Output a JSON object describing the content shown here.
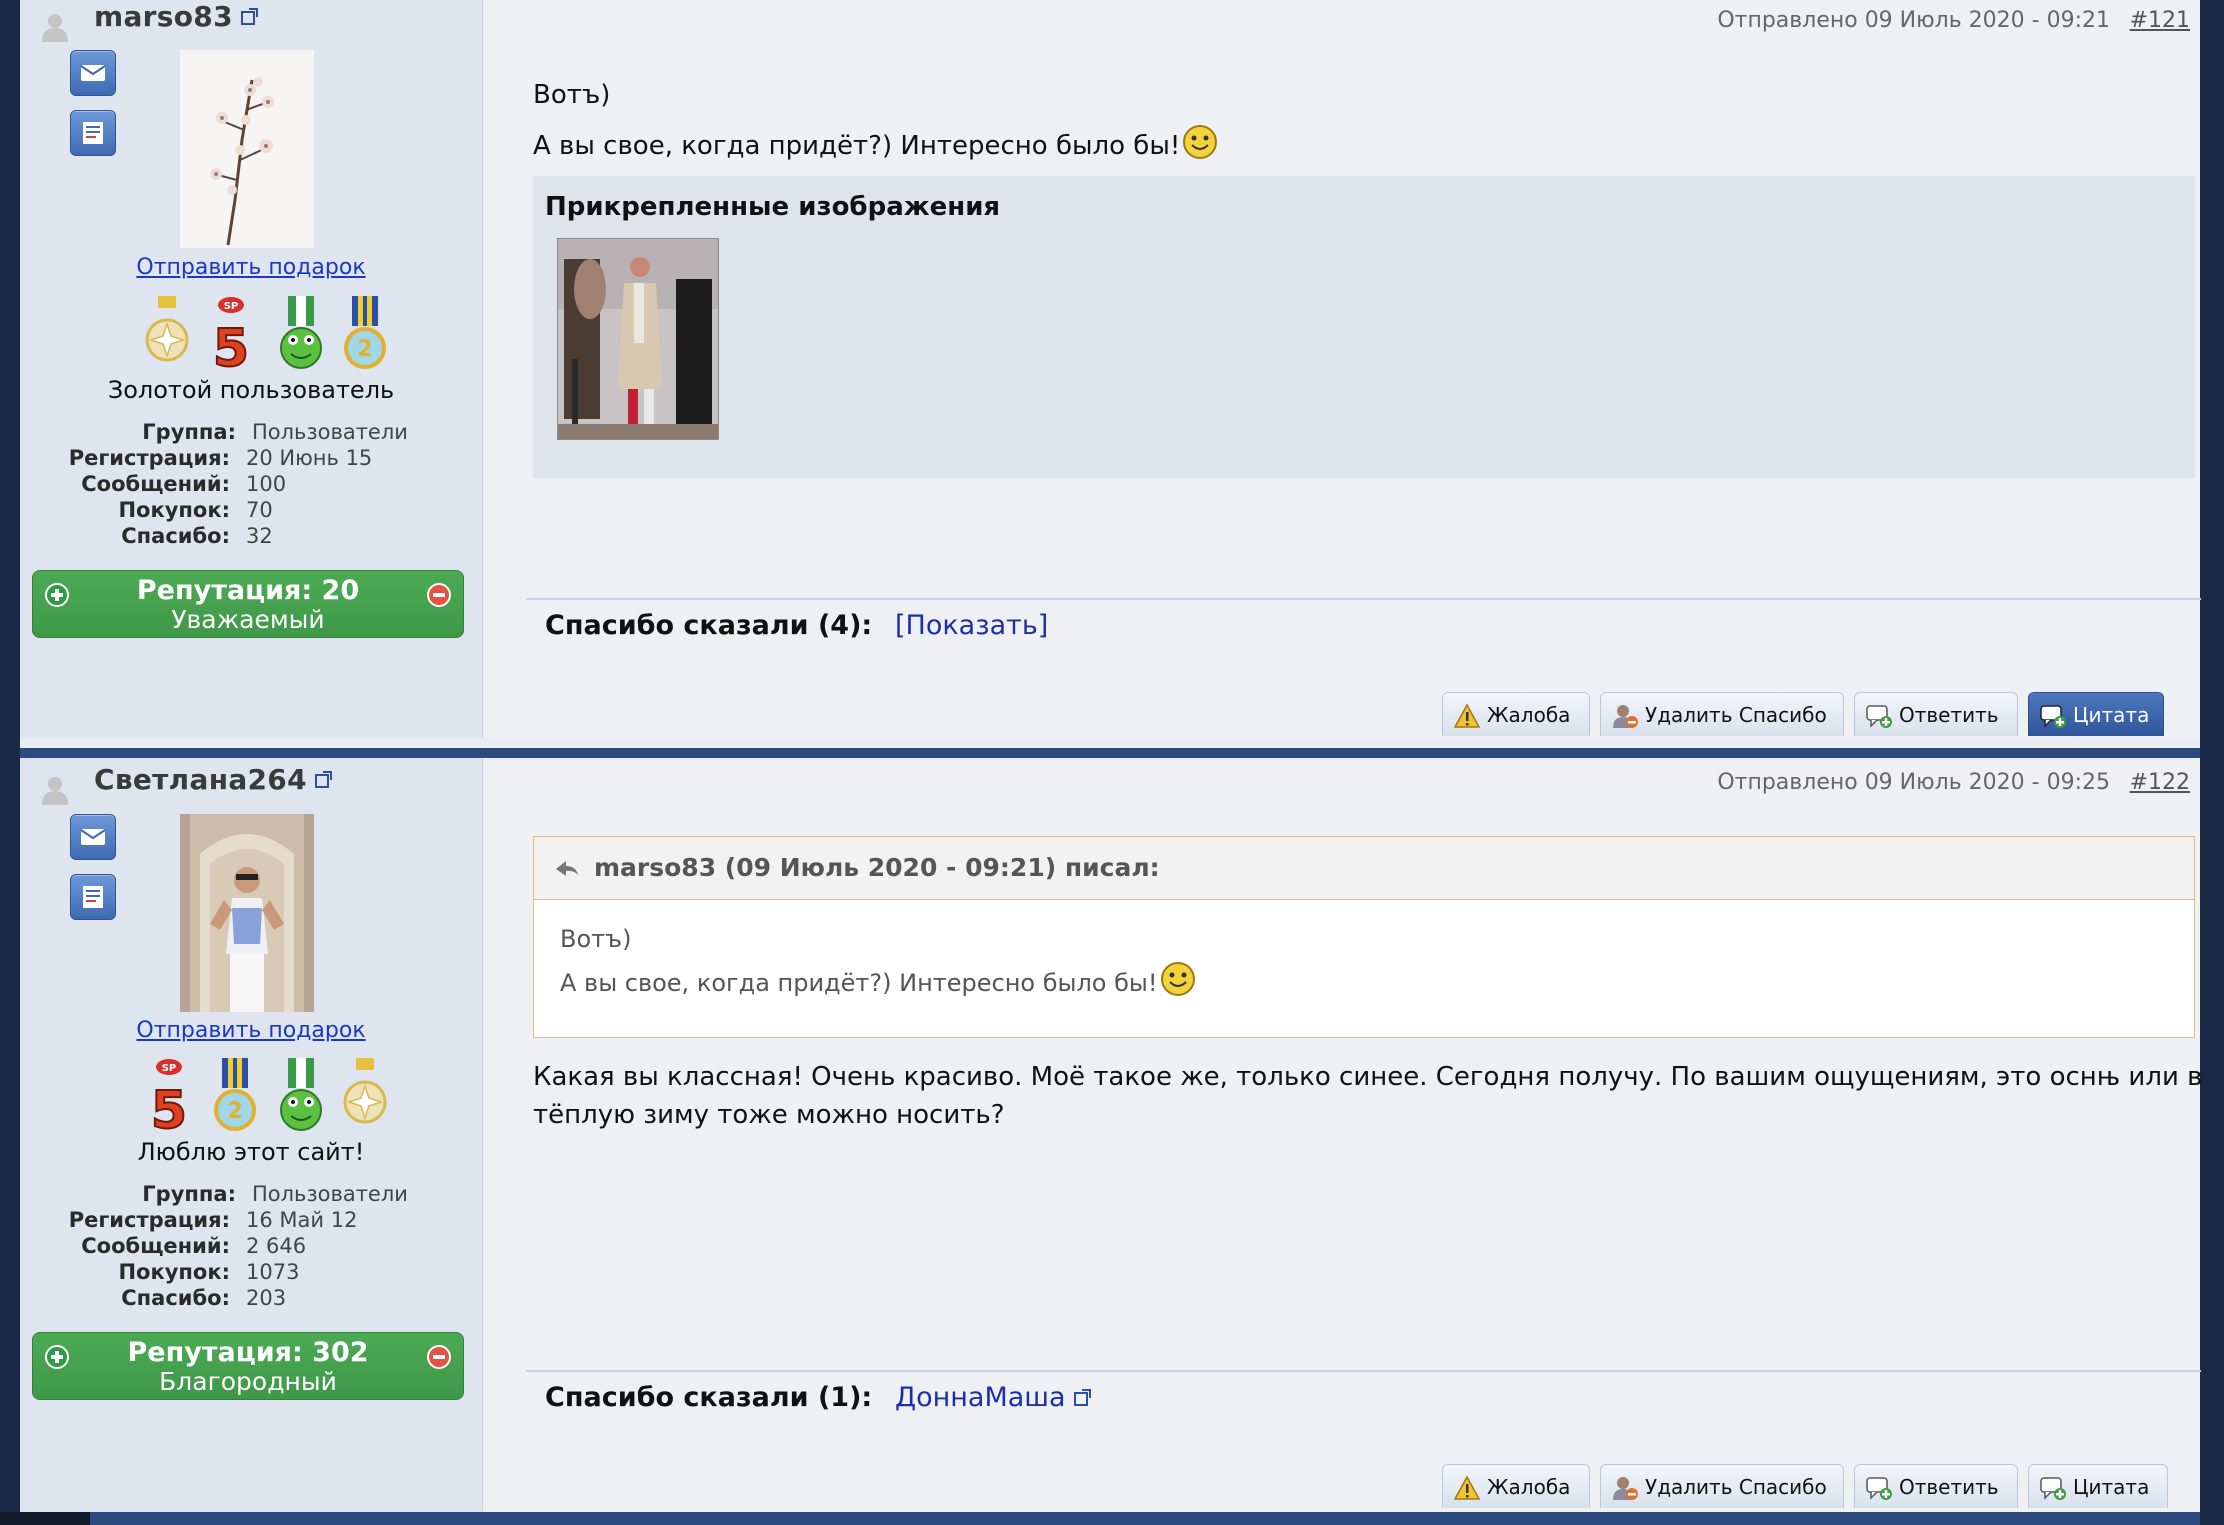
{
  "posts": [
    {
      "username": "marso83",
      "gift_link": "Отправить подарок",
      "rank_title": "Золотой пользователь",
      "stats": {
        "group_label": "Группа:",
        "group_value": "Пользователи",
        "reg_label": "Регистрация:",
        "reg_value": "20 Июнь 15",
        "msgs_label": "Сообщений:",
        "msgs_value": "100",
        "purchases_label": "Покупок:",
        "purchases_value": "70",
        "thanks_label": "Спасибо:",
        "thanks_value": "32"
      },
      "reputation": {
        "line1": "Репутация: 20",
        "line2": "Уважаемый"
      },
      "meta": "Отправлено 09 Июль 2020 - 09:21",
      "post_number": "#121",
      "body_line1": "Вотъ)",
      "body_line2": "А вы свое, когда придёт?) Интересно было бы!",
      "attachments_title": "Прикрепленные изображения",
      "thanks_said": "Спасибо сказали (4):",
      "thanks_link": "[Показать]",
      "medals": [
        "gold-star-medal",
        "sp5-medal",
        "frog-medal",
        "number-2-medal"
      ]
    },
    {
      "username": "Светлана264",
      "gift_link": "Отправить подарок",
      "rank_title": "Люблю этот сайт!",
      "stats": {
        "group_label": "Группа:",
        "group_value": "Пользователи",
        "reg_label": "Регистрация:",
        "reg_value": "16 Май 12",
        "msgs_label": "Сообщений:",
        "msgs_value": "2 646",
        "purchases_label": "Покупок:",
        "purchases_value": "1073",
        "thanks_label": "Спасибо:",
        "thanks_value": "203"
      },
      "reputation": {
        "line1": "Репутация: 302",
        "line2": "Благородный"
      },
      "meta": "Отправлено 09 Июль 2020 - 09:25",
      "post_number": "#122",
      "quote_header": "marso83 (09 Июль 2020 - 09:21) писал:",
      "quote_line1": "Вотъ)",
      "quote_line2": "А вы свое, когда придёт?) Интересно было бы!",
      "body_text": "Какая вы классная! Очень красиво. Моё такое же, только синее. Сегодня получу. По вашим ощущениям, это оснњ или в тёплую зиму тоже можно носить?",
      "thanks_said": "Спасибо сказали (1):",
      "thanks_link": "ДоннаМаша",
      "medals": [
        "sp5-medal",
        "number-2-medal",
        "frog-medal",
        "gold-star-medal"
      ]
    }
  ],
  "buttons": {
    "complaint": "Жалоба",
    "delete_thanks": "Удалить Спасибо",
    "reply": "Ответить",
    "quote": "Цитата"
  },
  "colors": {
    "accent_bar": "#2d4a7f",
    "reputation_green": "#45a24e",
    "link_blue": "#1a38c5"
  }
}
